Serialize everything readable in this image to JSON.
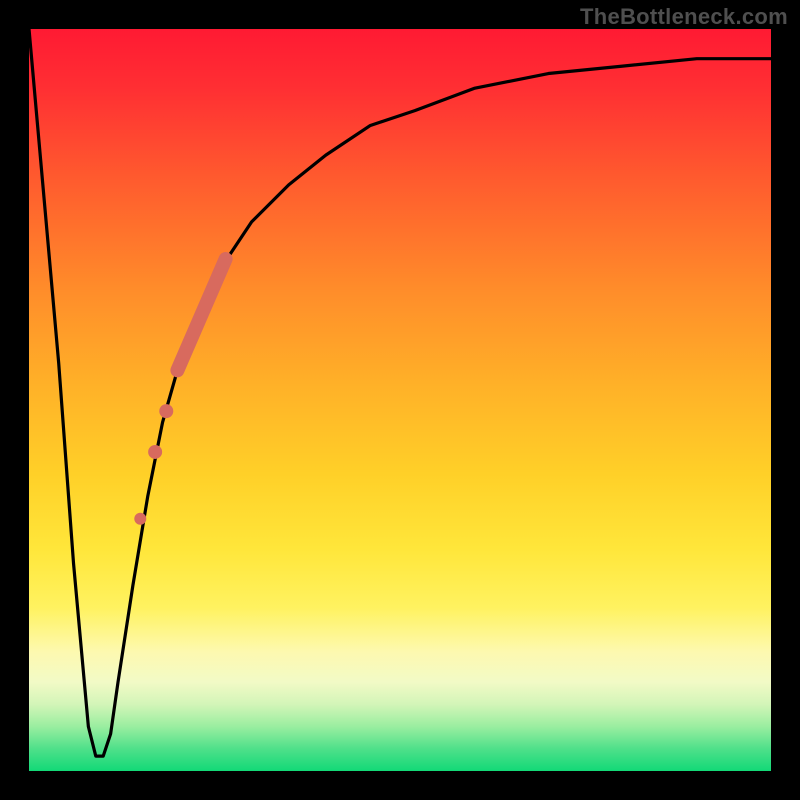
{
  "watermark": "TheBottleneck.com",
  "chart_data": {
    "type": "line",
    "title": "",
    "xlabel": "",
    "ylabel": "",
    "xlim": [
      0,
      100
    ],
    "ylim": [
      0,
      100
    ],
    "grid": false,
    "legend": false,
    "background_gradient": {
      "direction": "vertical",
      "stops": [
        {
          "pos": 0.0,
          "color": "#ff1a33"
        },
        {
          "pos": 0.5,
          "color": "#ffc028"
        },
        {
          "pos": 0.8,
          "color": "#fff260"
        },
        {
          "pos": 0.92,
          "color": "#c8f3b0"
        },
        {
          "pos": 1.0,
          "color": "#12d977"
        }
      ]
    },
    "series": [
      {
        "name": "bottleneck-curve",
        "color": "#000000",
        "x": [
          0,
          4,
          6,
          8,
          9,
          10,
          11,
          12,
          14,
          16,
          18,
          20,
          23,
          26,
          30,
          35,
          40,
          46,
          52,
          60,
          70,
          80,
          90,
          100
        ],
        "y": [
          100,
          55,
          28,
          6,
          2,
          2,
          5,
          12,
          25,
          37,
          47,
          54,
          62,
          68,
          74,
          79,
          83,
          87,
          89,
          92,
          94,
          95,
          96,
          96
        ]
      }
    ],
    "markers": [
      {
        "name": "highlight-band",
        "shape": "thick-line",
        "color": "#d86a5e",
        "width": 14,
        "x": [
          20.0,
          26.5
        ],
        "y": [
          54.0,
          69.0
        ]
      },
      {
        "name": "dot-1",
        "shape": "circle",
        "color": "#d86a5e",
        "r": 7,
        "x": 18.5,
        "y": 48.5
      },
      {
        "name": "dot-2",
        "shape": "circle",
        "color": "#d86a5e",
        "r": 7,
        "x": 17.0,
        "y": 43.0
      },
      {
        "name": "dot-3",
        "shape": "circle",
        "color": "#d86a5e",
        "r": 6,
        "x": 15.0,
        "y": 34.0
      }
    ]
  }
}
